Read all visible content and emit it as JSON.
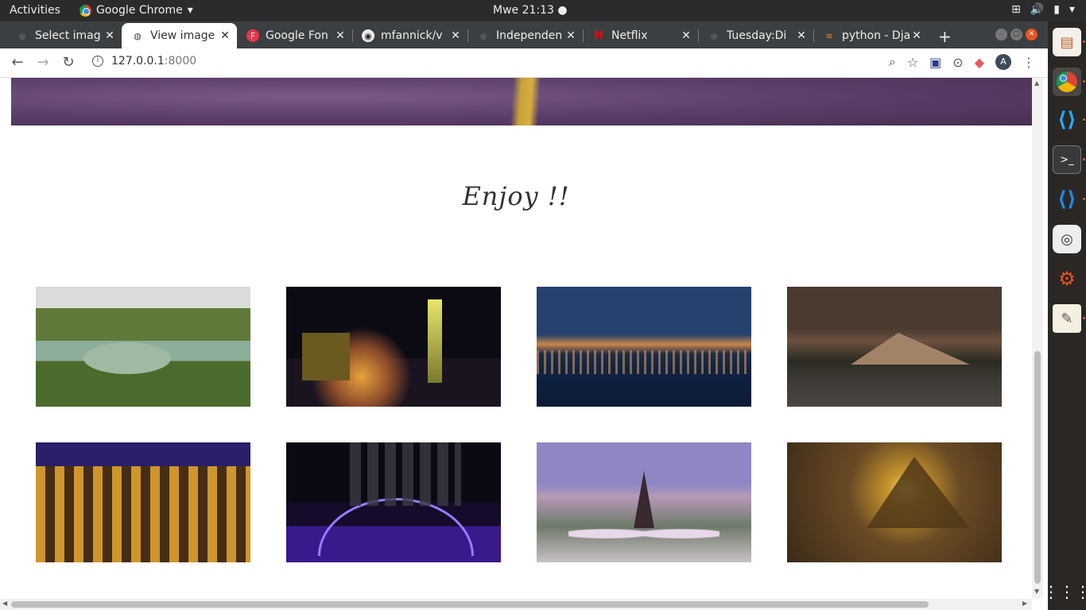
{
  "system": {
    "activities": "Activities",
    "app_name": "Google Chrome",
    "clock": "Mwe 21:13"
  },
  "tabs": [
    {
      "title": "Select imag",
      "favicon": "generic-icon",
      "active": false
    },
    {
      "title": "View image",
      "favicon": "globe-icon",
      "active": true
    },
    {
      "title": "Google Fon",
      "favicon": "google-fonts-icon",
      "active": false
    },
    {
      "title": "mfannick/v",
      "favicon": "github-icon",
      "active": false
    },
    {
      "title": "Independen",
      "favicon": "generic-icon",
      "active": false
    },
    {
      "title": "Netflix",
      "favicon": "netflix-icon",
      "active": false
    },
    {
      "title": "Tuesday:Di",
      "favicon": "generic-icon",
      "active": false
    },
    {
      "title": "python - Dja",
      "favicon": "stackoverflow-icon",
      "active": false
    }
  ],
  "addressbar": {
    "host": "127.0.0.1",
    "port": ":8000",
    "avatar_letter": "A"
  },
  "page": {
    "heading": "Enjoy !!",
    "gallery": [
      {
        "subject": "coastal-landscape-image"
      },
      {
        "subject": "city-night-skyline-image"
      },
      {
        "subject": "harbor-sunset-image"
      },
      {
        "subject": "mountain-lake-image"
      },
      {
        "subject": "colosseum-night-image"
      },
      {
        "subject": "lit-bridge-night-image"
      },
      {
        "subject": "eiffel-tower-image"
      },
      {
        "subject": "pyramids-sunset-image"
      }
    ]
  },
  "colors": {
    "top_bar": "#2b2b2b",
    "tab_strip": "#3c3f41",
    "dock": "#2a2725",
    "ubuntu_accent": "#e95420"
  }
}
